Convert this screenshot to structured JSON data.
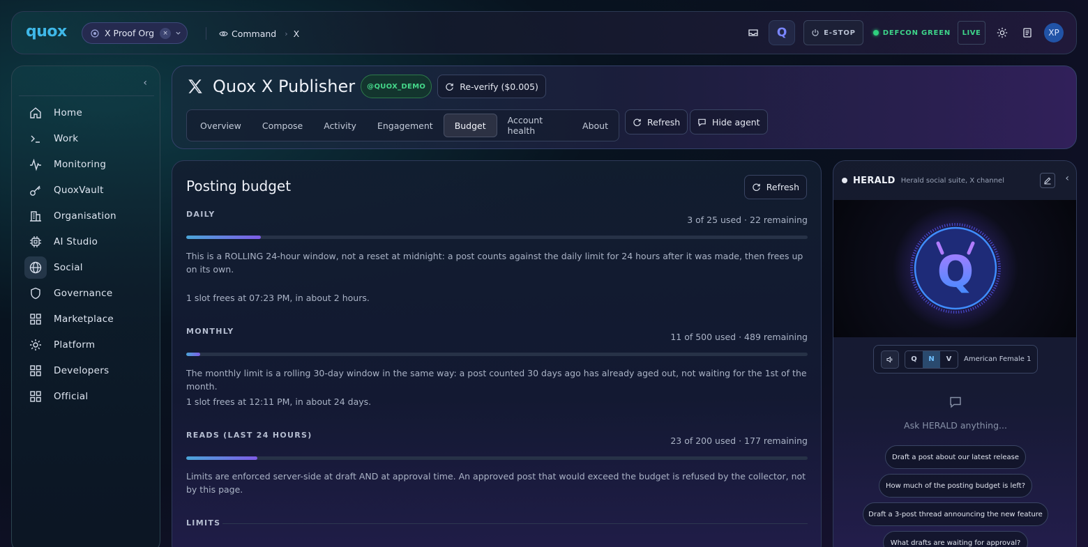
{
  "topbar": {
    "logo": "quox",
    "org": "X Proof Org",
    "org_clear": "×",
    "breadcrumbs": [
      "Command",
      "X"
    ],
    "estop": "E-STOP",
    "defcon": "DEFCON GREEN",
    "live": "LIVE",
    "user_initials": "XP",
    "q_glyph": "Q",
    "colors": {
      "status_green": "#2fd07e",
      "accent_blue": "#3fb8e8"
    }
  },
  "sidebar": {
    "collapse": "‹",
    "items": [
      {
        "label": "Home",
        "icon": "home-icon"
      },
      {
        "label": "Work",
        "icon": "terminal-icon"
      },
      {
        "label": "Monitoring",
        "icon": "activity-icon"
      },
      {
        "label": "QuoxVault",
        "icon": "key-icon"
      },
      {
        "label": "Organisation",
        "icon": "building-icon"
      },
      {
        "label": "AI Studio",
        "icon": "cpu-icon"
      },
      {
        "label": "Social",
        "icon": "globe-icon"
      },
      {
        "label": "Governance",
        "icon": "shield-icon"
      },
      {
        "label": "Marketplace",
        "icon": "grid-icon"
      },
      {
        "label": "Platform",
        "icon": "gear-icon"
      },
      {
        "label": "Developers",
        "icon": "grid-icon"
      },
      {
        "label": "Official",
        "icon": "grid-icon"
      }
    ],
    "active": "Social"
  },
  "header": {
    "title": "Quox X Publisher",
    "handle": "@QUOX_DEMO",
    "reverify": "Re-verify ($0.005)",
    "tabs": [
      "Overview",
      "Compose",
      "Activity",
      "Engagement",
      "Budget",
      "Account health",
      "About"
    ],
    "active_tab": "Budget",
    "refresh": "Refresh",
    "hide_agent": "Hide agent"
  },
  "budget": {
    "title": "Posting budget",
    "refresh": "Refresh",
    "daily": {
      "label": "DAILY",
      "count": "3 of 25 used · 22 remaining",
      "used_fraction": 0.12,
      "note": "This is a ROLLING 24-hour window, not a reset at midnight: a post counts against the daily limit for 24 hours after it was made, then frees up on its own.",
      "next": "1 slot frees at 07:23 PM, in about 2 hours."
    },
    "monthly": {
      "label": "MONTHLY",
      "count": "11 of 500 used · 489 remaining",
      "used_fraction": 0.022,
      "note": "The monthly limit is a rolling 30-day window in the same way: a post counted 30 days ago has already aged out, not waiting for the 1st of the month.",
      "next": "1 slot frees at 12:11 PM, in about 24 days."
    },
    "reads": {
      "label": "READS (LAST 24 HOURS)",
      "count": "23 of 200 used · 177 remaining",
      "used_fraction": 0.115,
      "note": "Limits are enforced server-side at draft AND at approval time. An approved post that would exceed the budget is refused by the collector, not by this page."
    },
    "limits_label": "LIMITS"
  },
  "agent": {
    "name": "HERALD",
    "subtitle": "Herald social suite, X channel",
    "hide": "‹",
    "avatar_glyph": "Q",
    "voice_modes": [
      "Q",
      "N",
      "V"
    ],
    "voice_active": "N",
    "voice_name": "American Female 1",
    "ask_placeholder": "Ask HERALD anything...",
    "suggestions": [
      "Draft a post about our latest release",
      "How much of the posting budget is left?",
      "Draft a 3-post thread announcing the new feature",
      "What drafts are waiting for approval?"
    ]
  }
}
